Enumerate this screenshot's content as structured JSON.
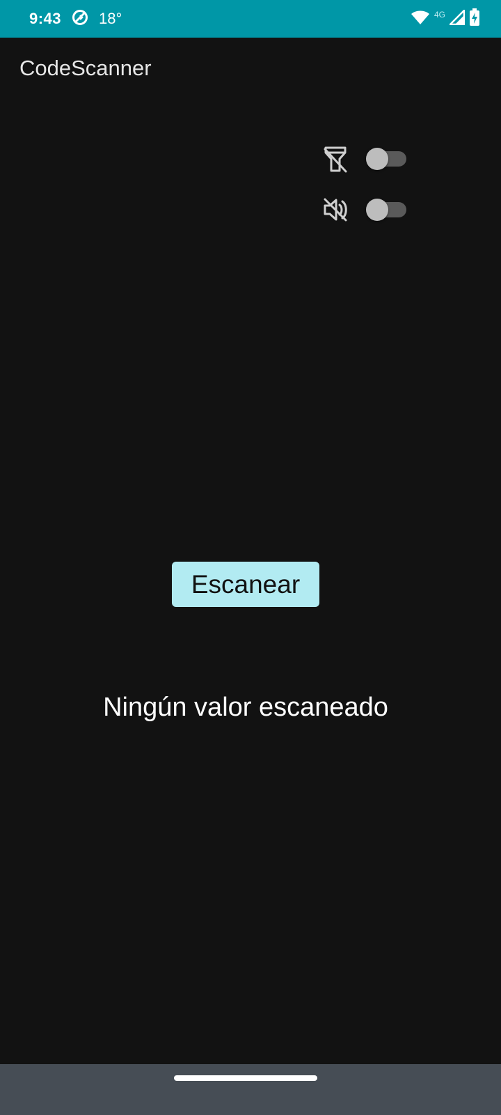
{
  "status_bar": {
    "time": "9:43",
    "temperature": "18°",
    "network": "4G",
    "background_color": "#0097a7",
    "icons": [
      "sync-icon",
      "wifi-icon",
      "signal-icon",
      "battery-charging-icon"
    ]
  },
  "app": {
    "title": "CodeScanner"
  },
  "controls": {
    "flash": {
      "icon": "flashlight-off-icon",
      "enabled": false
    },
    "sound": {
      "icon": "volume-off-icon",
      "enabled": false
    }
  },
  "scan_button": {
    "label": "Escanear",
    "background_color": "#b2ebf2"
  },
  "result": {
    "text": "Ningún valor escaneado"
  },
  "theme": {
    "background_color": "#121212",
    "nav_bar_color": "#464d55"
  }
}
